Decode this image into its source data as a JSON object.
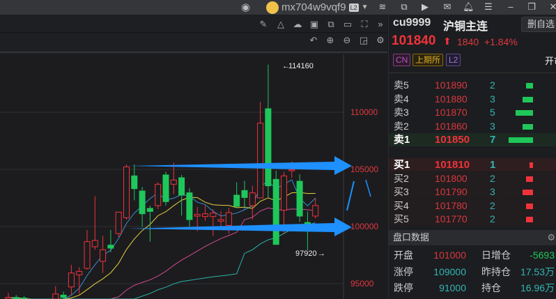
{
  "titlebar": {
    "username": "mx704w9vqf9",
    "level_badge": "L2"
  },
  "symbol": {
    "code": "cu9999",
    "name": "沪铜主连",
    "remove_watch_label": "删自选",
    "last_price": "101840",
    "change": "1840",
    "change_pct": "+1.84%",
    "tags": [
      "CN",
      "上期所",
      "L2"
    ],
    "status_partial": "开市"
  },
  "orderbook": {
    "asks": [
      {
        "label": "卖5",
        "price": "101890",
        "vol": "2",
        "bar": 0.3
      },
      {
        "label": "卖4",
        "price": "101880",
        "vol": "3",
        "bar": 0.43
      },
      {
        "label": "卖3",
        "price": "101870",
        "vol": "5",
        "bar": 0.71
      },
      {
        "label": "卖2",
        "price": "101860",
        "vol": "3",
        "bar": 0.43
      },
      {
        "label": "卖1",
        "price": "101850",
        "vol": "7",
        "bar": 1.0
      }
    ],
    "bids": [
      {
        "label": "买1",
        "price": "101810",
        "vol": "1",
        "bar": 0.14
      },
      {
        "label": "买2",
        "price": "101800",
        "vol": "2",
        "bar": 0.29
      },
      {
        "label": "买3",
        "price": "101790",
        "vol": "3",
        "bar": 0.43
      },
      {
        "label": "买4",
        "price": "101780",
        "vol": "2",
        "bar": 0.29
      },
      {
        "label": "买5",
        "price": "101770",
        "vol": "2",
        "bar": 0.29
      }
    ]
  },
  "stats": {
    "title": "盘口数据",
    "rows": [
      {
        "l1": "开盘",
        "v1": "101000",
        "l2": "日增仓",
        "v2": "-5693"
      },
      {
        "l1": "涨停",
        "v1": "109000",
        "l2": "昨持仓",
        "v2": "17.53万"
      },
      {
        "l1": "跌停",
        "v1": "91000",
        "l2": "持仓",
        "v2": "16.96万"
      }
    ]
  },
  "colors": {
    "up": "#f0333a",
    "down": "#1fc75a",
    "annot": "#1e90ff"
  },
  "chart_data": {
    "type": "candlestick",
    "y_ticks": [
      95000,
      100000,
      105000,
      110000
    ],
    "ylim": [
      93400,
      116500
    ],
    "high_label": "114160",
    "low_label": "97920",
    "candles": [
      [
        93600,
        94200,
        93400,
        93800
      ],
      [
        93800,
        94000,
        93500,
        93700
      ],
      [
        93700,
        93900,
        93500,
        93600
      ],
      [
        92500,
        93000,
        92000,
        92800
      ],
      [
        92800,
        93200,
        92400,
        93000
      ],
      [
        93000,
        93400,
        92600,
        93100
      ],
      [
        93600,
        94800,
        93200,
        94100
      ],
      [
        94000,
        94300,
        93400,
        93800
      ],
      [
        94713,
        96644,
        94001,
        95932
      ],
      [
        95770,
        96440,
        94103,
        96075
      ],
      [
        96339,
        99694,
        96237,
        98677
      ],
      [
        98230,
        102641,
        97966,
        98779
      ],
      [
        96949,
        99185,
        95932,
        97966
      ],
      [
        98372,
        99694,
        97762,
        98108
      ],
      [
        99389,
        101279,
        99084,
        101259
      ],
      [
        100771,
        105426,
        100608,
        105223
      ],
      [
        104430,
        105426,
        102296,
        103312
      ],
      [
        103108,
        103454,
        99958,
        101117
      ],
      [
        101584,
        101828,
        98677,
        101320
      ],
      [
        101828,
        103861,
        101523,
        103698
      ],
      [
        104512,
        104776,
        101828,
        102174
      ],
      [
        103698,
        105589,
        102845,
        104065
      ],
      [
        104268,
        104512,
        100954,
        102743
      ],
      [
        102946,
        103353,
        99999,
        100608
      ],
      [
        100913,
        101726,
        99592,
        101056
      ],
      [
        100873,
        101828,
        100506,
        101117
      ],
      [
        100873,
        101523,
        99185,
        101178
      ],
      [
        100466,
        101320,
        99897,
        100608
      ],
      [
        100100,
        101625,
        99389,
        101218
      ],
      [
        102743,
        103861,
        101625,
        101767
      ],
      [
        103149,
        104004,
        101523,
        102540
      ],
      [
        101828,
        103556,
        100608,
        102946
      ],
      [
        102499,
        110916,
        102499,
        109045
      ],
      [
        110306,
        114160,
        102499,
        103556
      ],
      [
        104126,
        104878,
        98433,
        98433
      ],
      [
        101422,
        104776,
        99389,
        104430
      ],
      [
        104878,
        105690,
        104268,
        104979
      ],
      [
        103963,
        104573,
        100405,
        100913
      ],
      [
        100354,
        101320,
        97920,
        100300
      ],
      [
        100913,
        102499,
        100710,
        101840
      ]
    ]
  }
}
